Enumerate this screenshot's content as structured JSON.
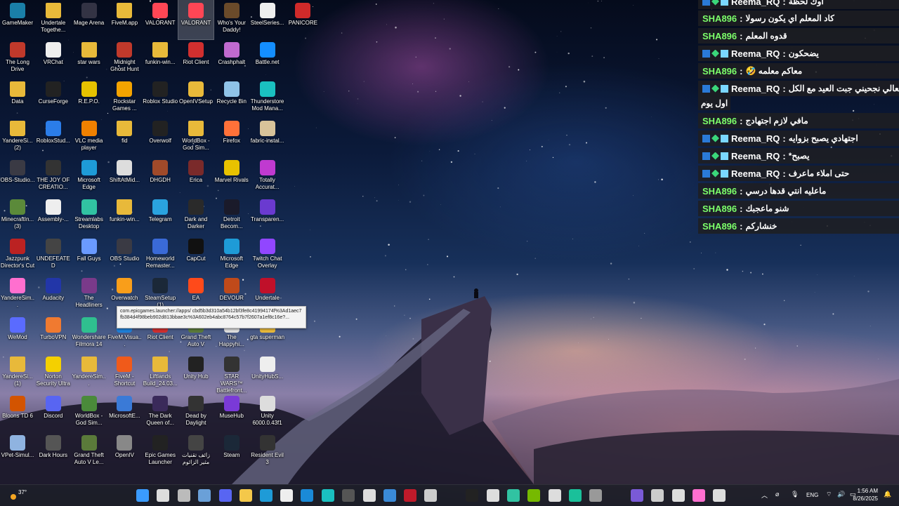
{
  "desktop": {
    "icons": [
      {
        "label": "GameMaker",
        "color": "#1a7fa8"
      },
      {
        "label": "The Long Drive",
        "color": "#c0392b"
      },
      {
        "label": "Data",
        "color": "#e8b93a",
        "folder": true
      },
      {
        "label": "YandereSi... (2)",
        "color": "#e8b93a",
        "folder": true
      },
      {
        "label": "OBS-Studio...",
        "color": "#3a3a44"
      },
      {
        "label": "MinecraftIn... (3)",
        "color": "#5b8a3a"
      },
      {
        "label": "Jazzpunk Director's Cut",
        "color": "#b22"
      },
      {
        "label": "YandereSim...",
        "color": "#ff6fcf"
      },
      {
        "label": "WeMod",
        "color": "#5a6bff"
      },
      {
        "label": "YandereSi... (1)",
        "color": "#e8b93a",
        "folder": true
      },
      {
        "label": "Bloons TD 6",
        "color": "#d35400"
      },
      {
        "label": "VPet-Simul...",
        "color": "#8fb3e0"
      },
      {
        "label": "Undertale Togethe...",
        "color": "#e8b93a",
        "folder": true
      },
      {
        "label": "VRChat",
        "color": "#eeeeee"
      },
      {
        "label": "CurseForge",
        "color": "#222222"
      },
      {
        "label": "RobloxStud...",
        "color": "#2b7de9"
      },
      {
        "label": "THE JOY OF CREATIO...",
        "color": "#333333"
      },
      {
        "label": "Assembly-...",
        "color": "#eeeeee"
      },
      {
        "label": "UNDEFEATED",
        "color": "#444444"
      },
      {
        "label": "Audacity",
        "color": "#2236a8"
      },
      {
        "label": "TurboVPN",
        "color": "#f07a30"
      },
      {
        "label": "Norton Security Ultra",
        "color": "#f4d000"
      },
      {
        "label": "Discord",
        "color": "#5865f2"
      },
      {
        "label": "Dark Hours",
        "color": "#555555"
      },
      {
        "label": "Mage Arena",
        "color": "#333344"
      },
      {
        "label": "star wars",
        "color": "#e8b93a",
        "folder": true
      },
      {
        "label": "R.E.P.O.",
        "color": "#e6c200"
      },
      {
        "label": "VLC media player",
        "color": "#f08000"
      },
      {
        "label": "Microsoft Edge",
        "color": "#1e9bd7"
      },
      {
        "label": "Streamlabs Desktop",
        "color": "#31c3a2"
      },
      {
        "label": "Fall Guys",
        "color": "#6a9aff"
      },
      {
        "label": "The Headliners",
        "color": "#7a3a8a"
      },
      {
        "label": "Wondershare Filmora 14",
        "color": "#2fbf8f"
      },
      {
        "label": "YandereSim...",
        "color": "#e8b93a",
        "folder": true
      },
      {
        "label": "WorldBox - God Sim...",
        "color": "#4a8a3a"
      },
      {
        "label": "Grand Theft Auto V Le...",
        "color": "#5a7a3a"
      },
      {
        "label": "FiveM.app",
        "color": "#e8b93a",
        "folder": true
      },
      {
        "label": "Midnight Ghost Hunt",
        "color": "#c0392b"
      },
      {
        "label": "Rockstar Games ...",
        "color": "#f4a300"
      },
      {
        "label": "fid",
        "color": "#e8b93a",
        "folder": true
      },
      {
        "label": "ShiftAtMid...",
        "color": "#dddddd"
      },
      {
        "label": "funkin-win...",
        "color": "#e8b93a",
        "folder": true
      },
      {
        "label": "OBS Studio",
        "color": "#3a3a44"
      },
      {
        "label": "Overwatch",
        "color": "#f99e1a"
      },
      {
        "label": "FiveM.Visua...",
        "color": "#1e7fd7"
      },
      {
        "label": "FiveM - Shortcut",
        "color": "#f05a1a"
      },
      {
        "label": "MicrosoftE...",
        "color": "#3a7ad7"
      },
      {
        "label": "OpenIV",
        "color": "#888888"
      },
      {
        "label": "VALORANT",
        "color": "#ff4655"
      },
      {
        "label": "funkin-win...",
        "color": "#e8b93a",
        "folder": true
      },
      {
        "label": "Roblox Studio",
        "color": "#222222"
      },
      {
        "label": "Overwolf",
        "color": "#222222"
      },
      {
        "label": "DHGDH",
        "color": "#a04a2a"
      },
      {
        "label": "Telegram",
        "color": "#2aa3df"
      },
      {
        "label": "Homeworld Remaster...",
        "color": "#3a6ad7"
      },
      {
        "label": "SteamSetup (1)",
        "color": "#1b2838"
      },
      {
        "label": "Riot Client",
        "color": "#d12f2f"
      },
      {
        "label": "Liftlands Build_24.03...",
        "color": "#e8b93a",
        "folder": true
      },
      {
        "label": "The Dark Queen of...",
        "color": "#3a2a5a"
      },
      {
        "label": "Epic Games Launcher",
        "color": "#222222"
      },
      {
        "label": "VALORANT",
        "color": "#ff4655",
        "selected": true
      },
      {
        "label": "Riot Client",
        "color": "#d12f2f"
      },
      {
        "label": "OpenIVSetup",
        "color": "#e8b93a"
      },
      {
        "label": "WorldBox - God Sim...",
        "color": "#e8b93a",
        "folder": true
      },
      {
        "label": "Erica",
        "color": "#7a2a2a"
      },
      {
        "label": "Dark and Darker",
        "color": "#2a2a2a"
      },
      {
        "label": "CapCut",
        "color": "#111111"
      },
      {
        "label": "EA",
        "color": "#ff4a1a"
      },
      {
        "label": "Grand Theft Auto V",
        "color": "#5a7a3a"
      },
      {
        "label": "Unity Hub",
        "color": "#222222"
      },
      {
        "label": "Dead by Daylight",
        "color": "#333333"
      },
      {
        "label": "زائف تقنيات مثير الزائوم",
        "color": "#444444"
      },
      {
        "label": "Who's Your Daddy!",
        "color": "#6a4a2a"
      },
      {
        "label": "Crashphalt",
        "color": "#c06ad0"
      },
      {
        "label": "Recycle Bin",
        "color": "#8fc3e8"
      },
      {
        "label": "Firefox",
        "color": "#ff7139"
      },
      {
        "label": "Marvel Rivals",
        "color": "#e8c200"
      },
      {
        "label": "Detroit Becom...",
        "color": "#1a1a2a"
      },
      {
        "label": "Microsoft Edge",
        "color": "#1e9bd7"
      },
      {
        "label": "DEVOUR",
        "color": "#c04a1a"
      },
      {
        "label": "The Happyhi...",
        "color": "#dddddd"
      },
      {
        "label": "STAR WARS™ Battlefront...",
        "color": "#333333"
      },
      {
        "label": "MuseHub",
        "color": "#7a3ad7"
      },
      {
        "label": "Steam",
        "color": "#1b2838"
      },
      {
        "label": "SteelSeries...",
        "color": "#eeeeee"
      },
      {
        "label": "Battle.net",
        "color": "#148eff"
      },
      {
        "label": "Thunderstore Mod Mana...",
        "color": "#1ac0c0"
      },
      {
        "label": "fabric-instal...",
        "color": "#d8c39a"
      },
      {
        "label": "Totally Accurat...",
        "color": "#c03ad0"
      },
      {
        "label": "Transparen...",
        "color": "#6a3ad0"
      },
      {
        "label": "Twitch Chat Overlay",
        "color": "#9146ff"
      },
      {
        "label": "Undertale",
        "color": "#c0102a"
      },
      {
        "label": "gta superman",
        "color": "#e8b93a",
        "folder": true
      },
      {
        "label": "UnityHubS...",
        "color": "#eeeeee"
      },
      {
        "label": "Unity 6000.0.43f1",
        "color": "#dddddd"
      },
      {
        "label": "Resident Evil 3",
        "color": "#333333"
      },
      {
        "label": "PANICORE",
        "color": "#d02a2a"
      }
    ]
  },
  "tooltip": {
    "text": "com.epicgames.launcher://apps/ cbd5b3d310a54b12bf3fe8c41994174f%3Ad1aec7fb384d4f98beb902d813bbae3c%3A602eb4abc8764c57b7f2607a1ef8c16e?..."
  },
  "chat": {
    "messages": [
      {
        "user": "Reema_RQ",
        "text": "اوك لحظة",
        "badges": true,
        "userColor": "#ffffff"
      },
      {
        "user": "SHA896",
        "text": "كاد المعلم اي يكون رسولا",
        "badges": false,
        "userColor": "#7cff6a"
      },
      {
        "user": "SHA896",
        "text": "قدوه المعلم",
        "badges": false,
        "userColor": "#7cff6a"
      },
      {
        "user": "Reema_RQ",
        "text": "يضحكون",
        "badges": true,
        "userColor": "#ffffff"
      },
      {
        "user": "SHA896",
        "text": "معاكم معلمه 🤣",
        "badges": false,
        "userColor": "#7cff6a"
      },
      {
        "user": "Reema_RQ",
        "text": "قد تعالي نجحيني جبت العيد مع الكل",
        "badges": true,
        "userColor": "#ffffff"
      },
      {
        "user": "SHA896",
        "text": "مافي لازم اجتهادج",
        "badges": false,
        "userColor": "#7cff6a"
      },
      {
        "user": "Reema_RQ",
        "text": "اجتهادي يصبح بزوايه",
        "badges": true,
        "userColor": "#ffffff"
      },
      {
        "user": "Reema_RQ",
        "text": "يصبح*",
        "badges": true,
        "userColor": "#ffffff"
      },
      {
        "user": "Reema_RQ",
        "text": "حتى املاء ماعرف",
        "badges": true,
        "userColor": "#ffffff"
      },
      {
        "user": "SHA896",
        "text": "ماعليه انتي قدها درسي",
        "badges": false,
        "userColor": "#7cff6a"
      },
      {
        "user": "SHA896",
        "text": "شنو ماعجبك",
        "badges": false,
        "userColor": "#7cff6a"
      },
      {
        "user": "SHA896",
        "text": "خنشاركم",
        "badges": false,
        "userColor": "#7cff6a"
      }
    ],
    "continuation": "اول يوم"
  },
  "taskbar": {
    "weather": "37°",
    "apps": [
      {
        "name": "start-button",
        "color": "#3a9bff"
      },
      {
        "name": "search",
        "color": "#dddddd"
      },
      {
        "name": "task-view",
        "color": "#bbbbbb"
      },
      {
        "name": "steam",
        "color": "#6aa0d8"
      },
      {
        "name": "discord",
        "color": "#5865f2"
      },
      {
        "name": "file-explorer",
        "color": "#f4c84a"
      },
      {
        "name": "edge",
        "color": "#1e9bd7"
      },
      {
        "name": "store",
        "color": "#eeeeee"
      },
      {
        "name": "app-blue",
        "color": "#1a8ad7"
      },
      {
        "name": "app-turquoise",
        "color": "#1ac0c0"
      },
      {
        "name": "app-v",
        "color": "#555555"
      },
      {
        "name": "app-paper",
        "color": "#dddddd"
      },
      {
        "name": "app-globe",
        "color": "#3a8ad7"
      },
      {
        "name": "app-red",
        "color": "#c01a2a"
      },
      {
        "name": "app-gear",
        "color": "#cccccc"
      },
      {
        "name": "curseforge",
        "color": "#222222"
      },
      {
        "name": "app-grid",
        "color": "#dddddd"
      },
      {
        "name": "streamlabs",
        "color": "#31c3a2"
      },
      {
        "name": "nvidia",
        "color": "#76b900"
      },
      {
        "name": "app-diamond",
        "color": "#dddddd"
      },
      {
        "name": "app-teal",
        "color": "#1ac09a"
      },
      {
        "name": "app-shield",
        "color": "#999999"
      },
      {
        "name": "app-purple",
        "color": "#7a5ad7"
      },
      {
        "name": "app-ring",
        "color": "#cccccc"
      },
      {
        "name": "app-settings",
        "color": "#dddddd"
      },
      {
        "name": "app-pink",
        "color": "#ff6fcf"
      },
      {
        "name": "unreal",
        "color": "#dddddd"
      }
    ],
    "tray": {
      "lang": "ENG",
      "time": "1:56 AM",
      "date": "8/26/2025"
    }
  }
}
